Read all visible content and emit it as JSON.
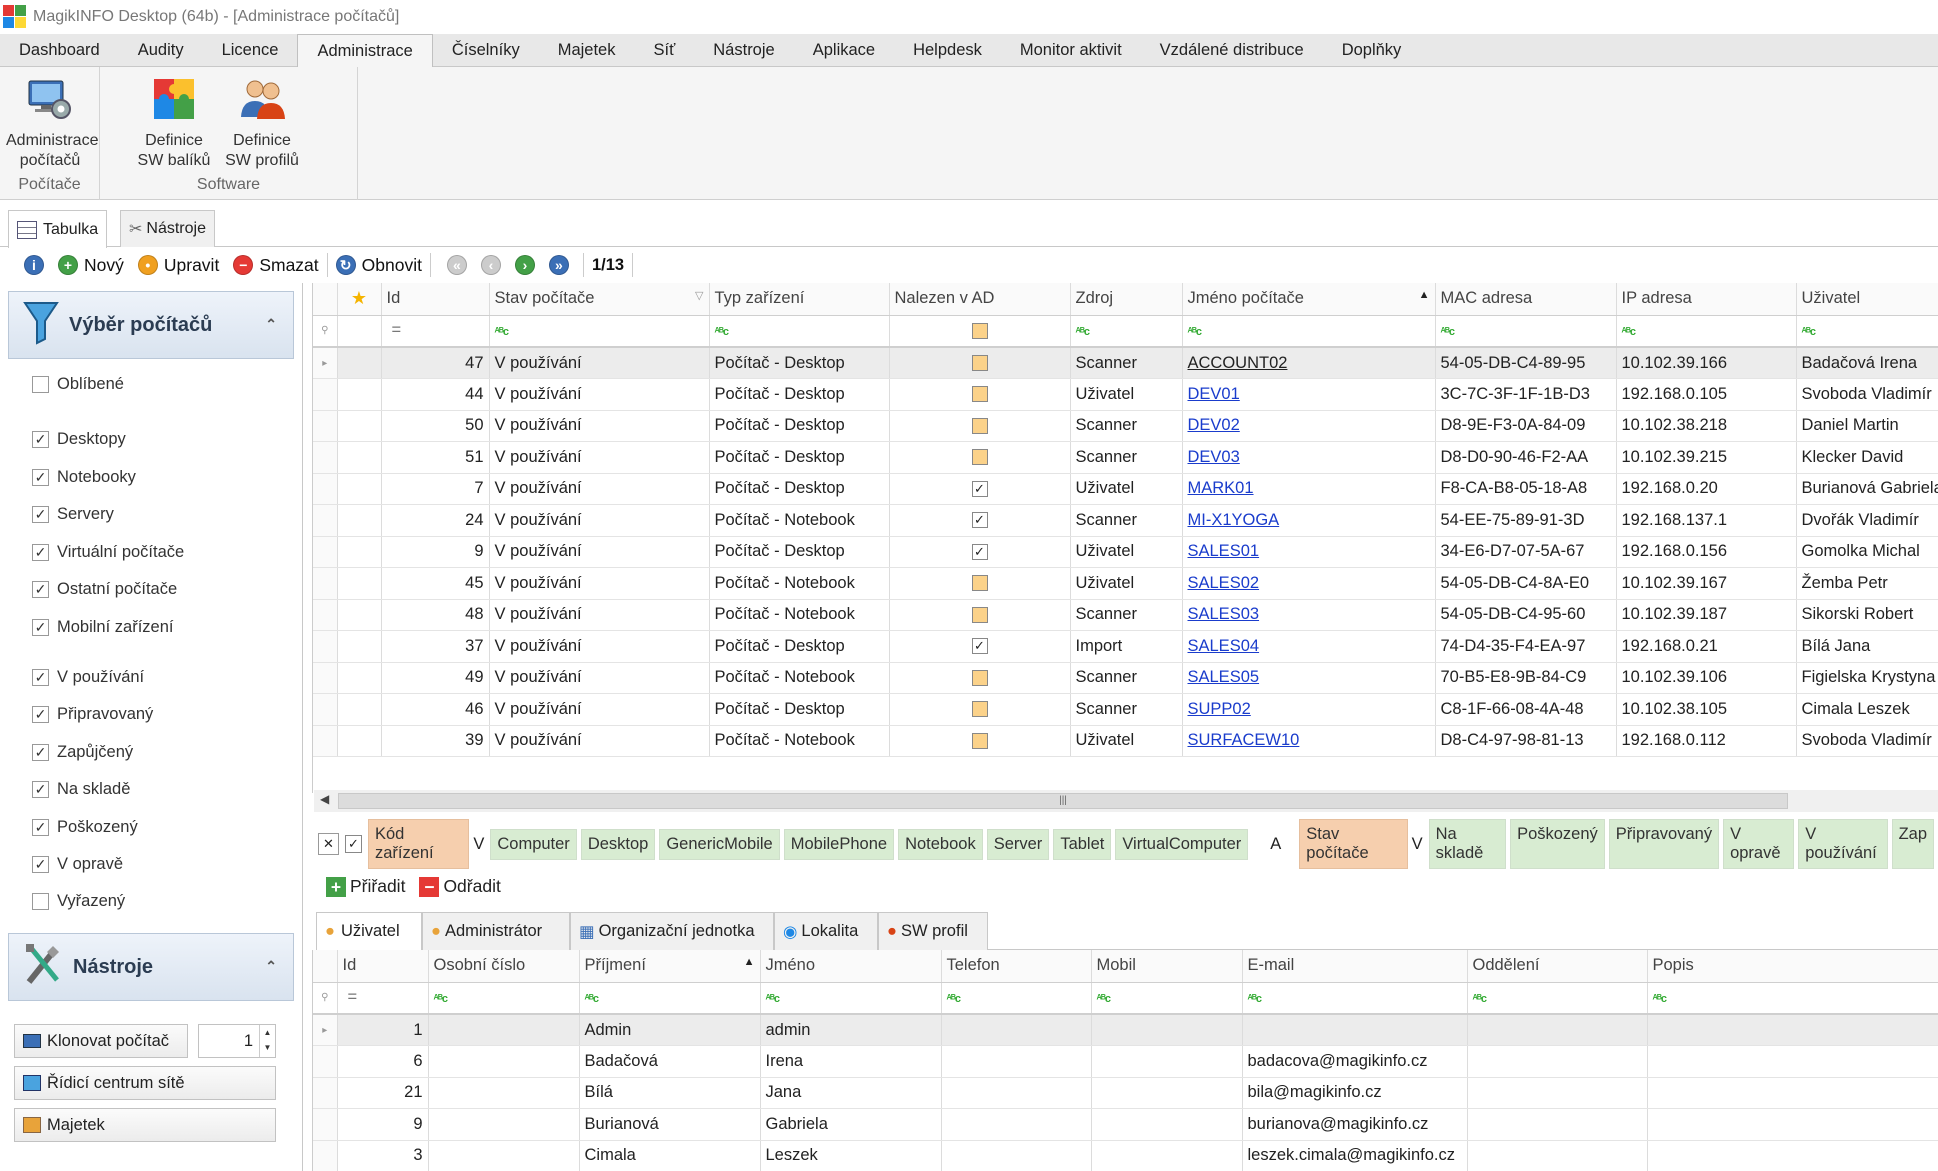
{
  "window": {
    "title": "MagikINFO Desktop (64b) - [Administrace počítačů]"
  },
  "menu": [
    "Dashboard",
    "Audity",
    "Licence",
    "Administrace",
    "Číselníky",
    "Majetek",
    "Síť",
    "Nástroje",
    "Aplikace",
    "Helpdesk",
    "Monitor aktivit",
    "Vzdálené distribuce",
    "Doplňky"
  ],
  "menu_active": "Administrace",
  "ribbon": {
    "buttons": [
      {
        "line1": "Administrace",
        "line2": "počítačů"
      },
      {
        "line1": "Definice",
        "line2": "SW balíků"
      },
      {
        "line1": "Definice",
        "line2": "SW profilů"
      }
    ],
    "groups": [
      "Počítače",
      "Software"
    ]
  },
  "subtabs": [
    "Tabulka",
    "Nástroje"
  ],
  "toolbar": {
    "new": "Nový",
    "edit": "Upravit",
    "delete": "Smazat",
    "refresh": "Obnovit",
    "page": "1/13"
  },
  "sidebar": {
    "panel1": "Výběr počítačů",
    "favorites": {
      "label": "Oblíbené",
      "checked": false
    },
    "types": [
      {
        "label": "Desktopy",
        "checked": true
      },
      {
        "label": "Notebooky",
        "checked": true
      },
      {
        "label": "Servery",
        "checked": true
      },
      {
        "label": "Virtuální počítače",
        "checked": true
      },
      {
        "label": "Ostatní počítače",
        "checked": true
      },
      {
        "label": "Mobilní zařízení",
        "checked": true
      }
    ],
    "states": [
      {
        "label": "V používání",
        "checked": true
      },
      {
        "label": "Připravovaný",
        "checked": true
      },
      {
        "label": "Zapůjčený",
        "checked": true
      },
      {
        "label": "Na skladě",
        "checked": true
      },
      {
        "label": "Poškozený",
        "checked": true
      },
      {
        "label": "V opravě",
        "checked": true
      },
      {
        "label": "Vyřazený",
        "checked": false
      }
    ],
    "panel2": "Nástroje",
    "clone": "Klonovat počítač",
    "clone_count": "1",
    "network": "Řídicí centrum sítě",
    "asset": "Majetek"
  },
  "main_grid": {
    "columns": [
      "Id",
      "Stav počítače",
      "Typ zařízení",
      "Nalezen v AD",
      "Zdroj",
      "Jméno počítače",
      "MAC adresa",
      "IP adresa",
      "Uživatel"
    ],
    "rows": [
      {
        "id": "47",
        "state": "V používání",
        "type": "Počítač - Desktop",
        "ad": false,
        "source": "Scanner",
        "name": "ACCOUNT02",
        "mac": "54-05-DB-C4-89-95",
        "ip": "10.102.39.166",
        "user": "Badačová Irena"
      },
      {
        "id": "44",
        "state": "V používání",
        "type": "Počítač - Desktop",
        "ad": false,
        "source": "Uživatel",
        "name": "DEV01",
        "mac": "3C-7C-3F-1F-1B-D3",
        "ip": "192.168.0.105",
        "user": "Svoboda Vladimír"
      },
      {
        "id": "50",
        "state": "V používání",
        "type": "Počítač - Desktop",
        "ad": false,
        "source": "Scanner",
        "name": "DEV02",
        "mac": "D8-9E-F3-0A-84-09",
        "ip": "10.102.38.218",
        "user": "Daniel Martin"
      },
      {
        "id": "51",
        "state": "V používání",
        "type": "Počítač - Desktop",
        "ad": false,
        "source": "Scanner",
        "name": "DEV03",
        "mac": "D8-D0-90-46-F2-AA",
        "ip": "10.102.39.215",
        "user": "Klecker David"
      },
      {
        "id": "7",
        "state": "V používání",
        "type": "Počítač - Desktop",
        "ad": true,
        "source": "Uživatel",
        "name": "MARK01",
        "mac": "F8-CA-B8-05-18-A8",
        "ip": "192.168.0.20",
        "user": "Burianová Gabriela"
      },
      {
        "id": "24",
        "state": "V používání",
        "type": "Počítač - Notebook",
        "ad": true,
        "source": "Scanner",
        "name": "MI-X1YOGA",
        "mac": "54-EE-75-89-91-3D",
        "ip": "192.168.137.1",
        "user": "Dvořák Vladimír"
      },
      {
        "id": "9",
        "state": "V používání",
        "type": "Počítač - Desktop",
        "ad": true,
        "source": "Uživatel",
        "name": "SALES01",
        "mac": "34-E6-D7-07-5A-67",
        "ip": "192.168.0.156",
        "user": "Gomolka Michal"
      },
      {
        "id": "45",
        "state": "V používání",
        "type": "Počítač - Notebook",
        "ad": false,
        "source": "Uživatel",
        "name": "SALES02",
        "mac": "54-05-DB-C4-8A-E0",
        "ip": "10.102.39.167",
        "user": "Žemba Petr"
      },
      {
        "id": "48",
        "state": "V používání",
        "type": "Počítač - Notebook",
        "ad": false,
        "source": "Scanner",
        "name": "SALES03",
        "mac": "54-05-DB-C4-95-60",
        "ip": "10.102.39.187",
        "user": "Sikorski Robert"
      },
      {
        "id": "37",
        "state": "V používání",
        "type": "Počítač - Desktop",
        "ad": true,
        "source": "Import",
        "name": "SALES04",
        "mac": "74-D4-35-F4-EA-97",
        "ip": "192.168.0.21",
        "user": "Bílá Jana"
      },
      {
        "id": "49",
        "state": "V používání",
        "type": "Počítač - Notebook",
        "ad": false,
        "source": "Scanner",
        "name": "SALES05",
        "mac": "70-B5-E8-9B-84-C9",
        "ip": "10.102.39.106",
        "user": "Figielska Krystyna"
      },
      {
        "id": "46",
        "state": "V používání",
        "type": "Počítač - Desktop",
        "ad": false,
        "source": "Scanner",
        "name": "SUPP02",
        "mac": "C8-1F-66-08-4A-48",
        "ip": "10.102.38.105",
        "user": "Cimala Leszek"
      },
      {
        "id": "39",
        "state": "V používání",
        "type": "Počítač - Notebook",
        "ad": false,
        "source": "Uživatel",
        "name": "SURFACEW10",
        "mac": "D8-C4-97-98-81-13",
        "ip": "192.168.0.112",
        "user": "Svoboda Vladimír"
      }
    ]
  },
  "filterbar": {
    "device_code_label": "Kód zařízení",
    "v1": "V",
    "device_codes": [
      "Computer",
      "Desktop",
      "GenericMobile",
      "MobilePhone",
      "Notebook",
      "Server",
      "Tablet",
      "VirtualComputer"
    ],
    "and": "A",
    "state_label": "Stav počítače",
    "v2": "V",
    "states": [
      "Na skladě",
      "Poškozený",
      "Připravovaný",
      "V opravě",
      "V používání",
      "Zap"
    ]
  },
  "assign": {
    "add": "Přiřadit",
    "remove": "Odřadit"
  },
  "bottom_tabs": [
    "Uživatel",
    "Administrátor",
    "Organizační jednotka",
    "Lokalita",
    "SW profil"
  ],
  "user_grid": {
    "columns": [
      "Id",
      "Osobní číslo",
      "Příjmení",
      "Jméno",
      "Telefon",
      "Mobil",
      "E-mail",
      "Oddělení",
      "Popis"
    ],
    "rows": [
      {
        "id": "1",
        "pn": "",
        "surname": "Admin",
        "name": "admin",
        "phone": "",
        "mobile": "",
        "email": "",
        "dept": "",
        "desc": ""
      },
      {
        "id": "6",
        "pn": "",
        "surname": "Badačová",
        "name": "Irena",
        "phone": "",
        "mobile": "",
        "email": "badacova@magikinfo.cz",
        "dept": "",
        "desc": ""
      },
      {
        "id": "21",
        "pn": "",
        "surname": "Bílá",
        "name": "Jana",
        "phone": "",
        "mobile": "",
        "email": "bila@magikinfo.cz",
        "dept": "",
        "desc": ""
      },
      {
        "id": "9",
        "pn": "",
        "surname": "Burianová",
        "name": "Gabriela",
        "phone": "",
        "mobile": "",
        "email": "burianova@magikinfo.cz",
        "dept": "",
        "desc": ""
      },
      {
        "id": "3",
        "pn": "",
        "surname": "Cimala",
        "name": "Leszek",
        "phone": "",
        "mobile": "",
        "email": "leszek.cimala@magikinfo.cz",
        "dept": "",
        "desc": ""
      }
    ]
  }
}
